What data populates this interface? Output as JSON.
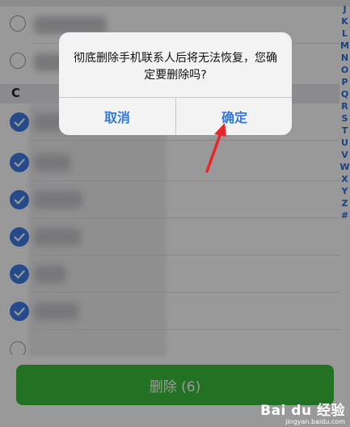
{
  "section": {
    "letter": "C"
  },
  "index_letters": [
    "J",
    "K",
    "L",
    "M",
    "N",
    "O",
    "P",
    "Q",
    "R",
    "S",
    "T",
    "U",
    "V",
    "W",
    "X",
    "Y",
    "Z",
    "#"
  ],
  "delete_button": {
    "label": "删除 (6)"
  },
  "dialog": {
    "message": "彻底删除手机联系人后将无法恢复，您确定要删除吗?",
    "cancel_label": "取消",
    "confirm_label": "确定"
  },
  "watermark": {
    "brand": "Bai du 经验",
    "url": "jingyan.baidu.com"
  },
  "colors": {
    "accent": "#2f7be6",
    "check": "#3f7de6",
    "delete": "#3bbf3b",
    "arrow": "#e8262b"
  }
}
